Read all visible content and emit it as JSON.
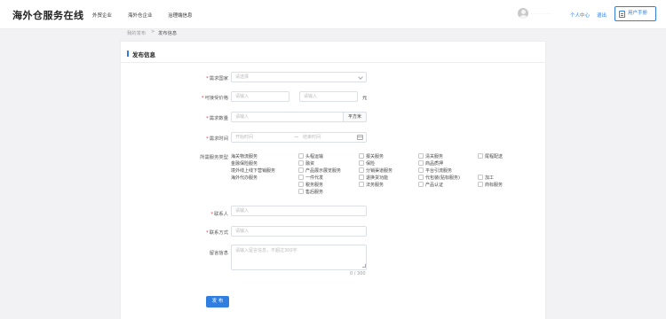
{
  "header": {
    "logo": "海外仓服务在线",
    "nav": [
      "外贸企业",
      "海外仓企业",
      "治理端信息"
    ],
    "username": "·········",
    "user_center": "个人中心",
    "logout": "退出",
    "manual": "用户手册"
  },
  "breadcrumb": {
    "parent": "我的发布",
    "separator": ">",
    "current": "发布信息"
  },
  "card": {
    "title": "发布信息"
  },
  "form": {
    "country": {
      "label": "需求国家",
      "placeholder": "请选择"
    },
    "price": {
      "label": "可接受价格",
      "min_placeholder": "请输入",
      "max_placeholder": "请输入",
      "unit": "元"
    },
    "quantity": {
      "label": "需求数量",
      "placeholder": "请输入",
      "unit": "平方米"
    },
    "time": {
      "label": "需求时间",
      "start_placeholder": "开始时间",
      "separator": "—",
      "end_placeholder": "结束时间"
    },
    "service": {
      "label": "所需服务类型",
      "col1": [
        "海关物流服务",
        "金融保险服务",
        "境外线上线下营销服务",
        "海外代办服务"
      ],
      "col2": [
        "头程运输",
        "融资",
        "产品展示展览服务",
        "一件代发",
        "税务服务",
        "售后服务"
      ],
      "col3": [
        "报关服务",
        "保险",
        "分销渠道服务",
        "退换货功能",
        "法务服务"
      ],
      "col4": [
        "清关服务",
        "商品质押",
        "平台引流服务",
        "代包装(贴标服务)",
        "产品认证"
      ],
      "col5": [
        "尾程配送",
        "加工",
        "商标服务"
      ]
    },
    "contact": {
      "label": "联系人",
      "placeholder": "请输入"
    },
    "phone": {
      "label": "联系方式",
      "placeholder": "请输入"
    },
    "message": {
      "label": "留言信息",
      "placeholder": "请输入留言信息，不超过300字",
      "counter": "0 / 300"
    },
    "submit": "发 布"
  },
  "colors": {
    "accent": "#2f7ee0",
    "required": "#e4393c",
    "background": "#f2f2f4"
  }
}
